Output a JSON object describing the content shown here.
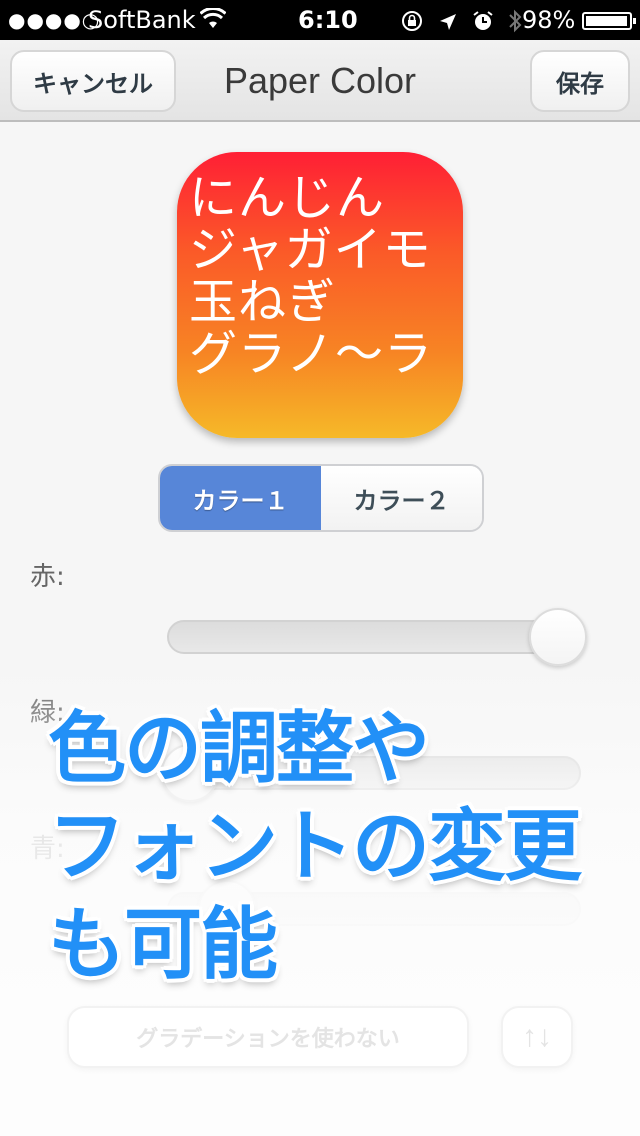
{
  "status_bar": {
    "signal": "●●●●○",
    "carrier": "SoftBank",
    "time": "6:10",
    "battery_percent": "98%",
    "battery_level": 0.98,
    "icons": [
      "rotation-lock-icon",
      "location-icon",
      "alarm-icon",
      "bluetooth-icon"
    ]
  },
  "nav": {
    "title": "Paper Color",
    "cancel_label": "キャンセル",
    "save_label": "保存"
  },
  "preview": {
    "lines": [
      "にんじん",
      "ジャガイモ",
      "玉ねぎ",
      "グラノ～ラ"
    ],
    "gradient_top": "#ff1f35",
    "gradient_bottom": "#f6b928"
  },
  "color_tabs": {
    "tabs": [
      {
        "label": "カラー１",
        "selected": true
      },
      {
        "label": "カラー２",
        "selected": false
      }
    ],
    "accent": "#5786d8"
  },
  "sliders": [
    {
      "label": "赤:",
      "value": 1.0
    },
    {
      "label": "緑:",
      "value": 0.0
    },
    {
      "label": "青:",
      "value": 0.1
    }
  ],
  "buttons": {
    "gradient_label": "グラデーションを使わない",
    "swap_label": "↑↓"
  },
  "promo": {
    "lines": [
      "色の調整や",
      "フォントの変更",
      "も可能"
    ],
    "color": "#2290f7"
  }
}
